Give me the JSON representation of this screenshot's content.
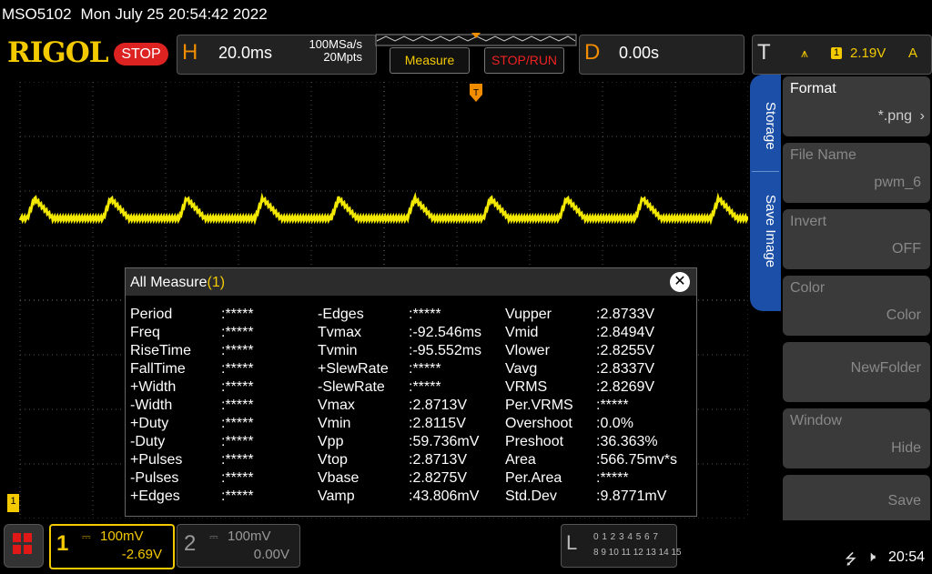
{
  "header": {
    "model": "MSO5102",
    "datetime": "Mon July 25 20:54:42 2022",
    "brand": "RIGOL",
    "run_state": "STOP"
  },
  "horizontal": {
    "letter": "H",
    "timebase": "20.0ms",
    "sample_rate": "100MSa/s",
    "memory_depth": "20Mpts"
  },
  "toolbar": {
    "measure_label": "Measure",
    "stoprun_label": "STOP/RUN"
  },
  "delay": {
    "letter": "D",
    "value": "0.00s"
  },
  "trigger": {
    "letter": "T",
    "channel": "1",
    "level": "2.19V",
    "mode": "A",
    "color": "#f3c900"
  },
  "side_tabs": {
    "tab1": "Storage",
    "tab2": "Save Image"
  },
  "side_menu": [
    {
      "label": "Format",
      "value": "*.png",
      "enabled": true
    },
    {
      "label": "File Name",
      "value": "pwm_6",
      "enabled": false
    },
    {
      "label": "Invert",
      "value": "OFF",
      "enabled": false
    },
    {
      "label": "Color",
      "value": "Color",
      "enabled": false
    },
    {
      "label": "",
      "value": "NewFolder",
      "enabled": false
    },
    {
      "label": "Window",
      "value": "Hide",
      "enabled": false
    },
    {
      "label": "",
      "value": "Save",
      "enabled": false
    }
  ],
  "measure_dialog": {
    "title": "All Measure",
    "count": "(1)",
    "columns": [
      [
        [
          "Period",
          ":*****"
        ],
        [
          "Freq",
          ":*****"
        ],
        [
          "RiseTime",
          ":*****"
        ],
        [
          "FallTime",
          ":*****"
        ],
        [
          "+Width",
          ":*****"
        ],
        [
          "-Width",
          ":*****"
        ],
        [
          "+Duty",
          ":*****"
        ],
        [
          "-Duty",
          ":*****"
        ],
        [
          "+Pulses",
          ":*****"
        ],
        [
          "-Pulses",
          ":*****"
        ],
        [
          "+Edges",
          ":*****"
        ]
      ],
      [
        [
          "-Edges",
          ":*****"
        ],
        [
          "Tvmax",
          ":-92.546ms"
        ],
        [
          "Tvmin",
          ":-95.552ms"
        ],
        [
          "+SlewRate",
          ":*****"
        ],
        [
          "-SlewRate",
          ":*****"
        ],
        [
          "Vmax",
          ":2.8713V"
        ],
        [
          "Vmin",
          ":2.8115V"
        ],
        [
          "Vpp",
          ":59.736mV"
        ],
        [
          "Vtop",
          ":2.8713V"
        ],
        [
          "Vbase",
          ":2.8275V"
        ],
        [
          "Vamp",
          ":43.806mV"
        ]
      ],
      [
        [
          "Vupper",
          ":2.8733V"
        ],
        [
          "Vmid",
          ":2.8494V"
        ],
        [
          "Vlower",
          ":2.8255V"
        ],
        [
          "Vavg",
          ":2.8337V"
        ],
        [
          "VRMS",
          ":2.8269V"
        ],
        [
          "Per.VRMS",
          ":*****"
        ],
        [
          "Overshoot",
          ":0.0%"
        ],
        [
          "Preshoot",
          ":36.363%"
        ],
        [
          "Area",
          ":566.75mv*s"
        ],
        [
          "Per.Area",
          ":*****"
        ],
        [
          "Std.Dev",
          ":9.8771mV"
        ]
      ]
    ]
  },
  "channels": {
    "ch1": {
      "num": "1",
      "scale": "100mV",
      "offset": "-2.69V",
      "color": "#f3c900"
    },
    "ch2": {
      "num": "2",
      "scale": "100mV",
      "offset": "0.00V",
      "color": "#999999"
    }
  },
  "la": {
    "letter": "L",
    "row1": "0 1 2 3  4 5 6 7",
    "row2": "8 9 10 11 12 13 14 15"
  },
  "status": {
    "time": "20:54"
  },
  "markers": {
    "ground": "1"
  }
}
